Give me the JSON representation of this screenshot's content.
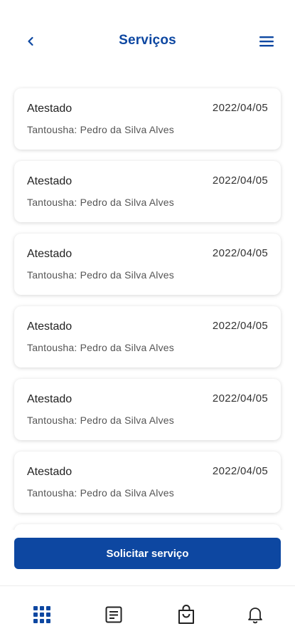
{
  "header": {
    "title": "Serviços"
  },
  "services": [
    {
      "type": "Atestado",
      "date": "2022/04/05",
      "person": "Tantousha: Pedro da Silva Alves"
    },
    {
      "type": "Atestado",
      "date": "2022/04/05",
      "person": "Tantousha: Pedro da Silva Alves"
    },
    {
      "type": "Atestado",
      "date": "2022/04/05",
      "person": "Tantousha: Pedro da Silva Alves"
    },
    {
      "type": "Atestado",
      "date": "2022/04/05",
      "person": "Tantousha: Pedro da Silva Alves"
    },
    {
      "type": "Atestado",
      "date": "2022/04/05",
      "person": "Tantousha: Pedro da Silva Alves"
    },
    {
      "type": "Atestado",
      "date": "2022/04/05",
      "person": "Tantousha: Pedro da Silva Alves"
    }
  ],
  "cta": {
    "label": "Solicitar serviço"
  },
  "bottom_nav": {
    "items": [
      {
        "icon": "grid-icon",
        "active": true
      },
      {
        "icon": "document-icon",
        "active": false
      },
      {
        "icon": "shopping-bag-icon",
        "active": false
      },
      {
        "icon": "bell-icon",
        "active": false
      }
    ]
  },
  "colors": {
    "primary": "#0d47a1",
    "text": "#222222",
    "muted": "#555555"
  }
}
